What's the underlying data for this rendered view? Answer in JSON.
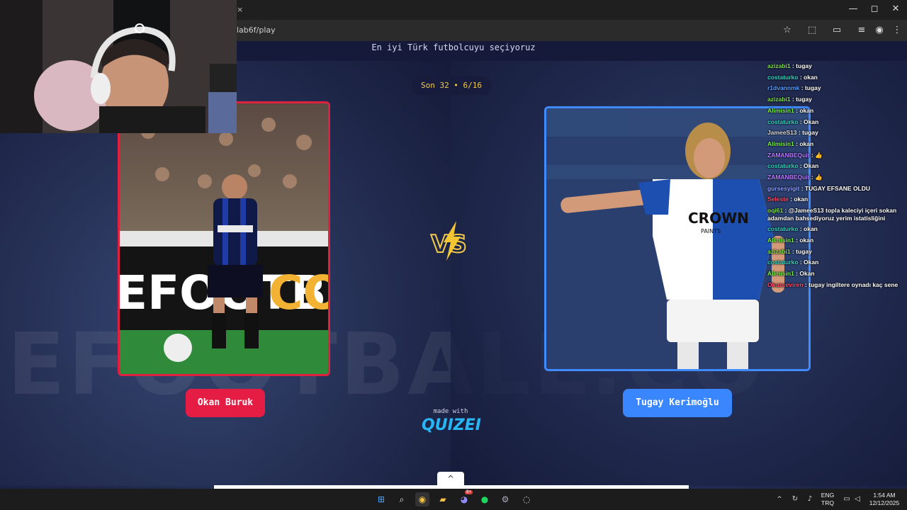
{
  "browser": {
    "tab_close": "×",
    "url": "lab6f/play",
    "window_controls": {
      "minimize": "—",
      "maximize": "◻",
      "close": "✕"
    },
    "toolbar_icons": [
      "star-icon",
      "extensions-icon",
      "cast-icon",
      "reading-list-icon",
      "profile-icon",
      "more-icon"
    ]
  },
  "page": {
    "subtitle": "En iyi Türk futbolcuyu seçiyoruz",
    "round": "Son 32 • 6/16",
    "left": {
      "name": "Okan Buruk",
      "ghost_text": "EFOOTBALL.CO"
    },
    "right": {
      "name": "Tugay Kerimoğlu",
      "sponsor": "CROWN",
      "sponsor_sub": "PAINTS"
    },
    "vs": "VS",
    "made_with": "made with",
    "brand": "QUIZEI",
    "scroll_up": "^",
    "colors": {
      "left_accent": "#e51c44",
      "right_accent": "#3a86ff",
      "round_text": "#f2c94c"
    }
  },
  "chat": [
    {
      "user": "azizabi1",
      "msg": "tugay",
      "color": "#7fe04a"
    },
    {
      "user": "costaturko",
      "msg": "okan",
      "color": "#35d6c6"
    },
    {
      "user": "r1dvannmk",
      "msg": "tugay",
      "color": "#5aa0ff"
    },
    {
      "user": "azizabi1",
      "msg": "tugay",
      "color": "#7fe04a"
    },
    {
      "user": "Alimisin1",
      "msg": "okan",
      "color": "#7cf04a"
    },
    {
      "user": "costaturko",
      "msg": "Okan",
      "color": "#35d6c6"
    },
    {
      "user": "JameeS13",
      "msg": "tugay",
      "color": "#dcdcdc"
    },
    {
      "user": "Alimisin1",
      "msg": "okan",
      "color": "#7cf04a"
    },
    {
      "user": "ZAMANBEQuit",
      "msg": "👍",
      "color": "#b77cff"
    },
    {
      "user": "costaturko",
      "msg": "Okan",
      "color": "#35d6c6"
    },
    {
      "user": "ZAMANBEQuit",
      "msg": "👍",
      "color": "#b77cff"
    },
    {
      "user": "gursesyigit",
      "msg": "TUGAY EFSANE OLDU",
      "color": "#8fa0ff"
    },
    {
      "user": "Seleste",
      "msg": "okan",
      "color": "#ff4d6d"
    },
    {
      "user": "oqi61",
      "msg": "@JameeS13 topla kaleciyi içeri sokan adamdan bahsediyoruz yerim istatisliğini",
      "color": "#7fe04a",
      "wrap": true
    },
    {
      "user": "costaturko",
      "msg": "okan",
      "color": "#35d6c6"
    },
    {
      "user": "Alimisin1",
      "msg": "okan",
      "color": "#7cf04a"
    },
    {
      "user": "azizabi1",
      "msg": "tugay",
      "color": "#7fe04a"
    },
    {
      "user": "costaturko",
      "msg": "Okan",
      "color": "#35d6c6"
    },
    {
      "user": "Alimisin1",
      "msg": "Okan",
      "color": "#7cf04a"
    },
    {
      "user": "Okuzceviren",
      "msg": "tugay ingiltere oynadı kaç sene",
      "color": "#ff4d6d"
    }
  ],
  "taskbar": {
    "lang_top": "ENG",
    "lang_bottom": "TRQ",
    "time": "1:54 AM",
    "date": "12/12/2025",
    "badge": "9+"
  }
}
